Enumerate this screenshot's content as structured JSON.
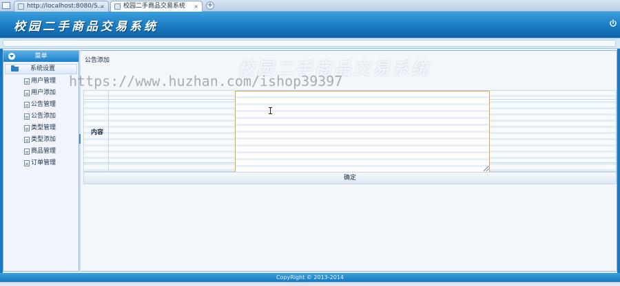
{
  "browser": {
    "tabs": [
      {
        "label": "http://localhost:8080/S...",
        "active": false
      },
      {
        "label": "校园二手商品交易系统",
        "active": true
      }
    ],
    "tab_close_glyph": "×",
    "new_tab_glyph": "+"
  },
  "header": {
    "title": "校园二手商品交易系统",
    "power_icon": "power-icon"
  },
  "sidebar": {
    "menu_label": "菜单",
    "group_label": "系统设置",
    "items": [
      {
        "label": "用户管理"
      },
      {
        "label": "用户添加"
      },
      {
        "label": "公告管理"
      },
      {
        "label": "公告添加"
      },
      {
        "label": "类型管理"
      },
      {
        "label": "类型添加"
      },
      {
        "label": "商品管理"
      },
      {
        "label": "订单管理"
      }
    ]
  },
  "main": {
    "breadcrumb": "公告添加",
    "content_label": "内容",
    "content_value": "",
    "submit_label": "确定"
  },
  "watermark": {
    "url_text": "https://www.huzhan.com/ishop39397",
    "logo_text": "校园二手商品交易系统"
  },
  "footer": {
    "copyright": "CopyRight © 2013-2014"
  },
  "colors": {
    "header_blue": "#1778bf",
    "editor_border": "#e4a34a"
  }
}
